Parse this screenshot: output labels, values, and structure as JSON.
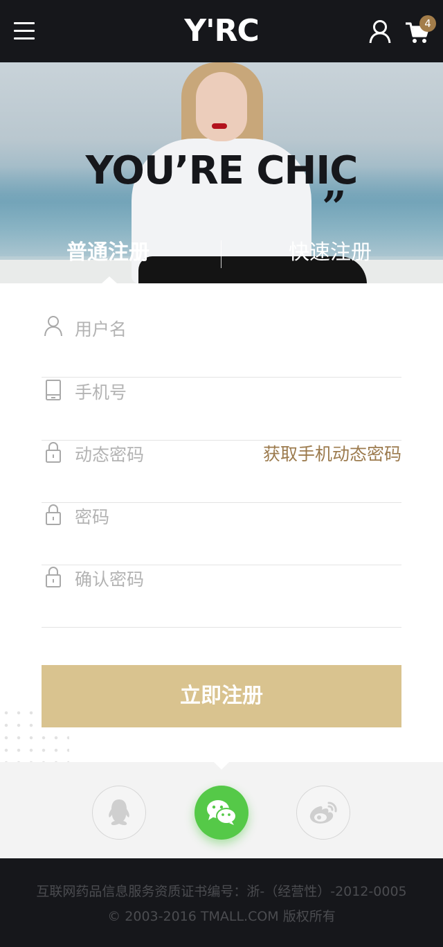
{
  "header": {
    "logo": "Y'RC",
    "cart_count": "4"
  },
  "hero": {
    "slogan": "YOU’RE  CHIC",
    "quote": "”",
    "tabs": [
      {
        "label": "普通注册"
      },
      {
        "label": "快速注册"
      }
    ]
  },
  "form": {
    "username_placeholder": "用户名",
    "phone_placeholder": "手机号",
    "sms_code_placeholder": "动态密码",
    "get_code_label": "获取手机动态密码",
    "password_placeholder": "密码",
    "confirm_placeholder": "确认密码",
    "submit_label": "立即注册"
  },
  "social": {
    "icons": [
      "qq-icon",
      "wechat-icon",
      "weibo-icon"
    ]
  },
  "footer": {
    "license": "互联网药品信息服务资质证书编号：浙-（经营性）-2012-0005",
    "copyright": "© 2003-2016 TMALL.COM 版权所有"
  },
  "colors": {
    "header_bg": "#16171b",
    "accent_gold": "#d9c38f",
    "link_gold": "#9c7b4e",
    "wechat_green": "#55c948"
  }
}
